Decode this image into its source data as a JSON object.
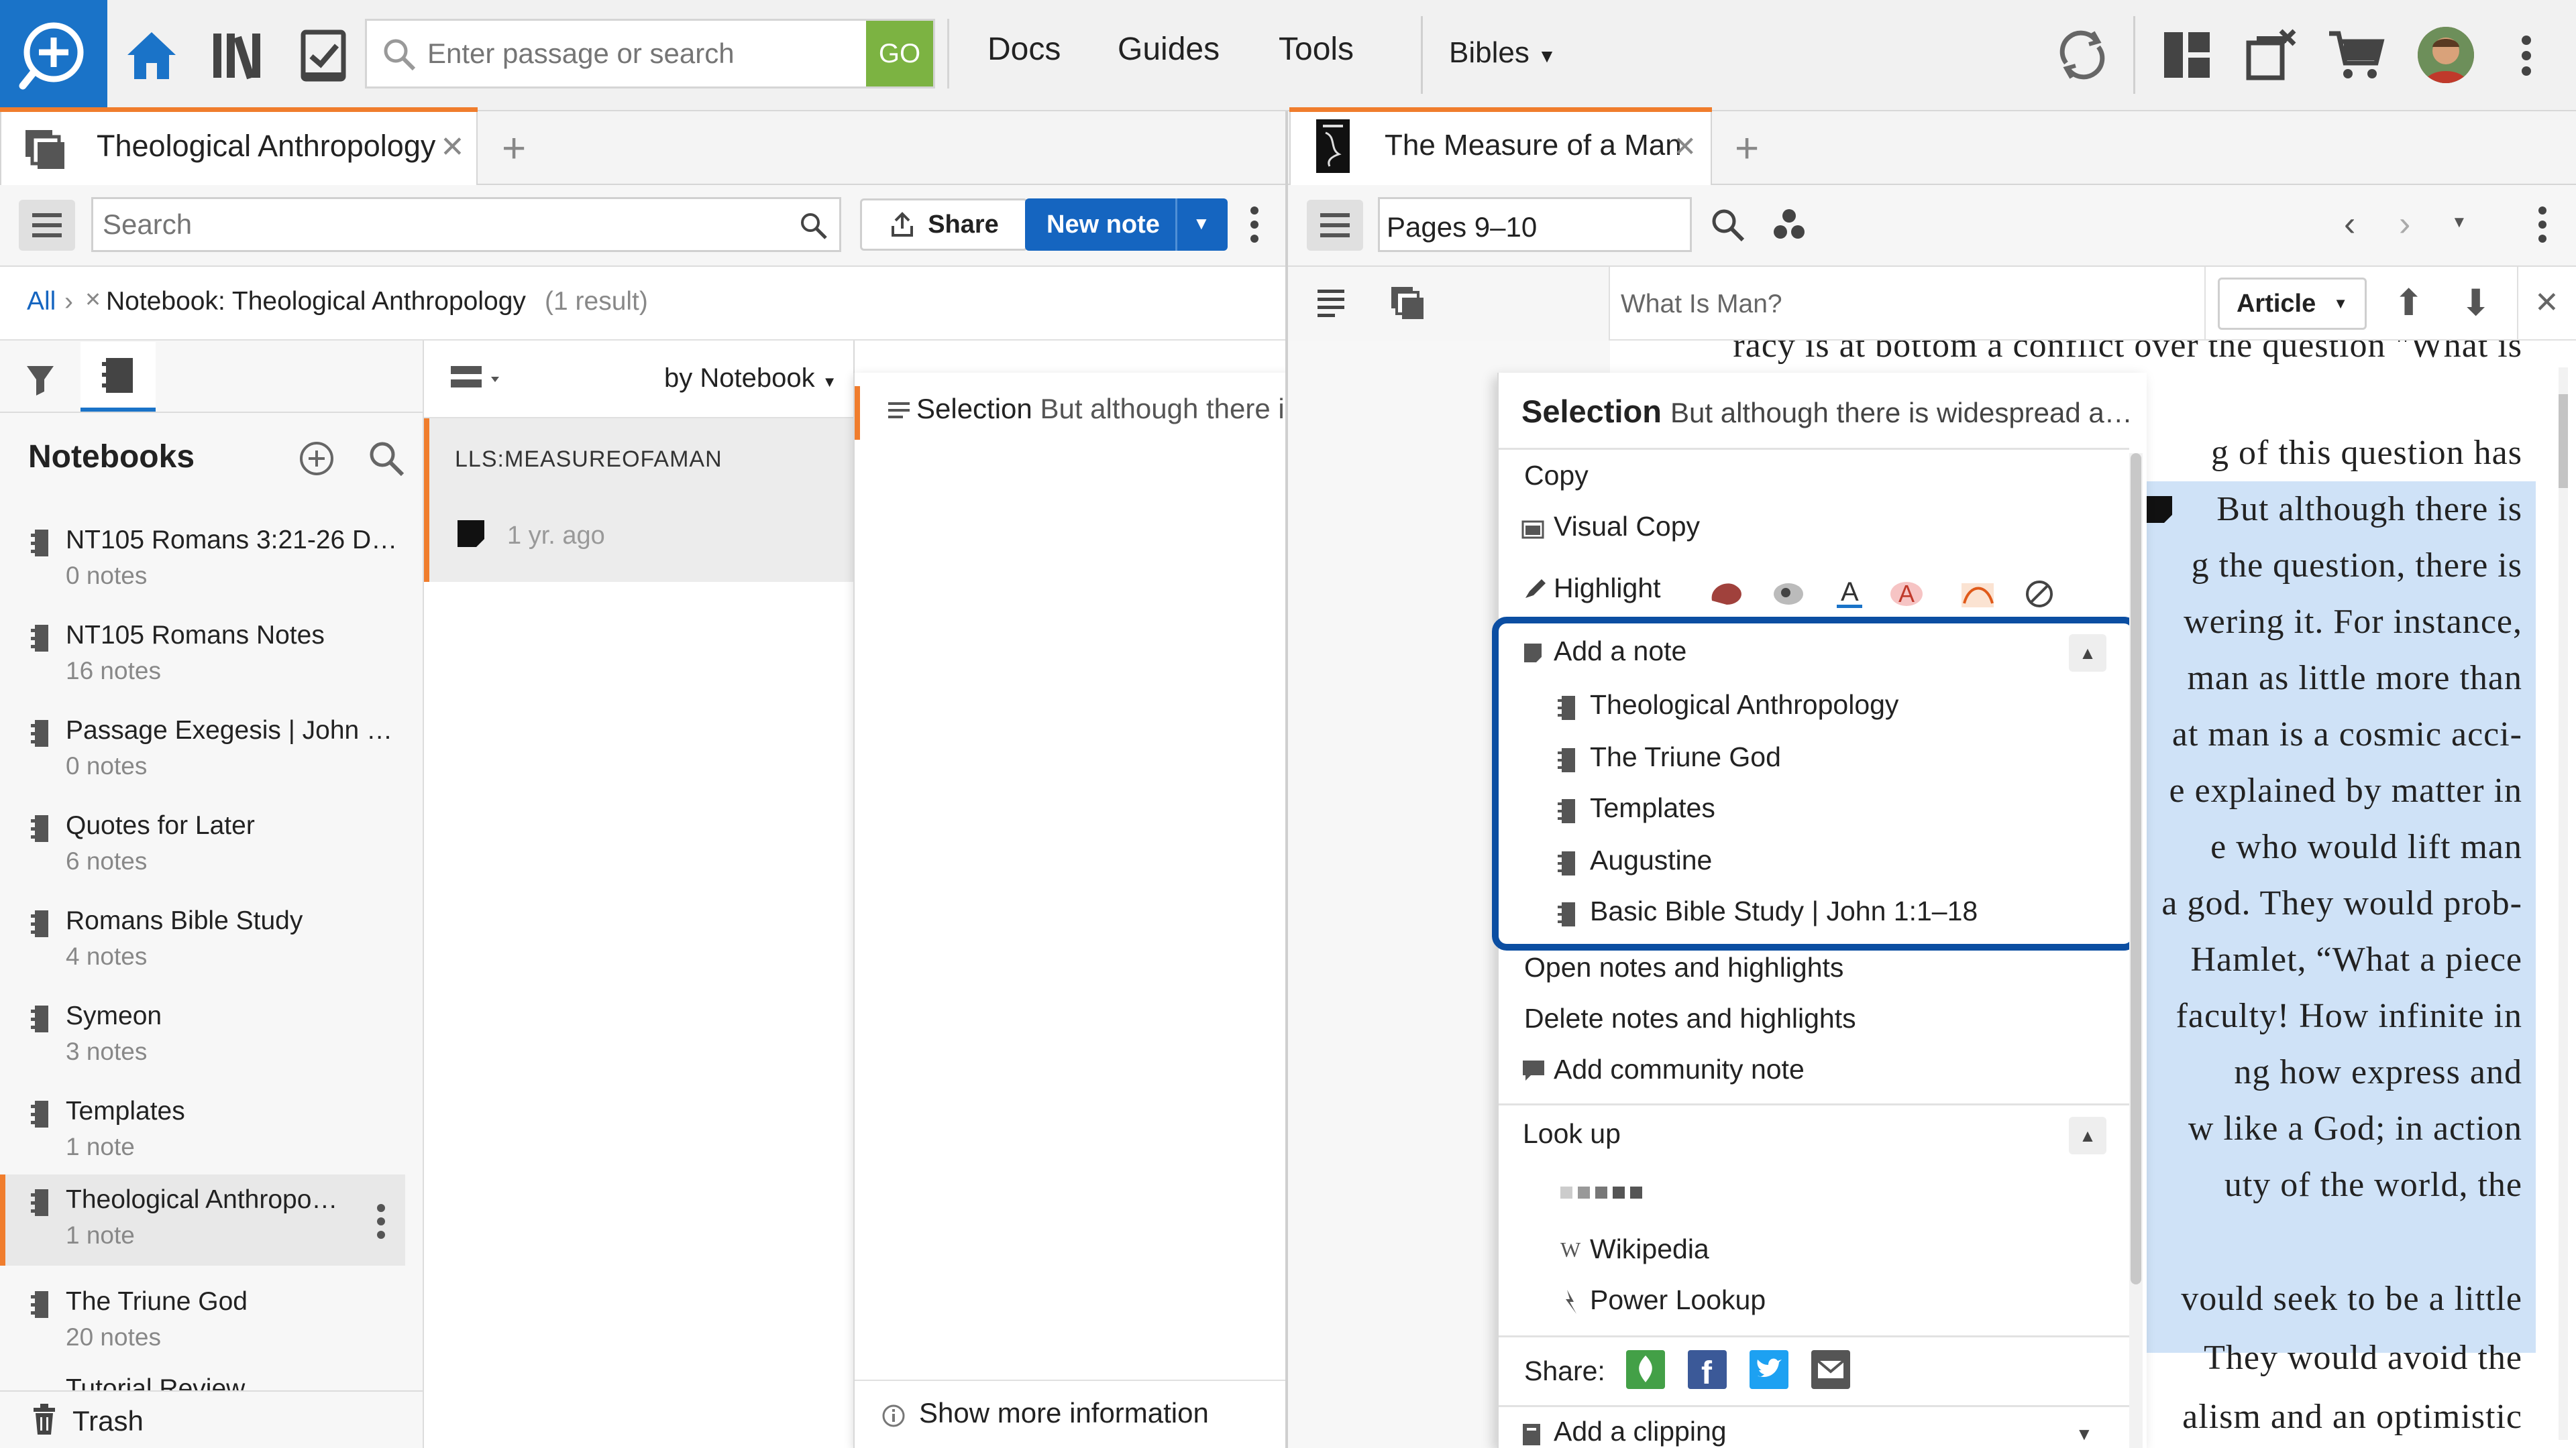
{
  "app": {
    "search_placeholder": "Enter passage or search",
    "go_label": "GO",
    "menu": {
      "docs": "Docs",
      "guides": "Guides",
      "tools": "Tools",
      "bibles": "Bibles"
    }
  },
  "left_panel": {
    "tab_title": "Theological Anthropology",
    "search_placeholder": "Search",
    "share_label": "Share",
    "new_note_label": "New note",
    "breadcrumb": {
      "all": "All",
      "separator": "›",
      "filter": "Notebook: Theological Anthropology",
      "result_count": "(1 result)"
    },
    "notebooks_title": "Notebooks",
    "sort_label": "by Notebook",
    "notebooks": [
      {
        "title": "NT105 Romans 3:21-26 Di…",
        "count": "0 notes"
      },
      {
        "title": "NT105 Romans Notes",
        "count": "16 notes"
      },
      {
        "title": "Passage Exegesis | John 1…",
        "count": "0 notes"
      },
      {
        "title": "Quotes for Later",
        "count": "6 notes"
      },
      {
        "title": "Romans Bible Study",
        "count": "4 notes"
      },
      {
        "title": "Symeon",
        "count": "3 notes"
      },
      {
        "title": "Templates",
        "count": "1 note"
      },
      {
        "title": "Theological Anthropo…",
        "count": "1 note"
      },
      {
        "title": "The Triune God",
        "count": "20 notes"
      },
      {
        "title": "Tutorial Review",
        "count": ""
      }
    ],
    "trash_label": "Trash",
    "note_group": "LLS:MEASUREOFAMAN",
    "note_time": "1 yr. ago",
    "note_editor": {
      "selection_title": "Selection",
      "selection_text": "But although there is widesprea…",
      "show_more": "Show more information"
    }
  },
  "context_menu": {
    "header_title": "Selection",
    "header_text": "But although there is widespread a…",
    "copy": "Copy",
    "visual_copy": "Visual Copy",
    "highlight": "Highlight",
    "add_note": "Add a note",
    "notebooks": [
      "Theological Anthropology",
      "The Triune God",
      "Templates",
      "Augustine",
      "Basic Bible Study | John 1:1–18"
    ],
    "open_notes": "Open notes and highlights",
    "delete_notes": "Delete notes and highlights",
    "community_note": "Add community note",
    "look_up": "Look up",
    "wikipedia": "Wikipedia",
    "power_lookup": "Power Lookup",
    "share": "Share:",
    "add_clipping": "Add a clipping",
    "focus_color": "#0b4ea2"
  },
  "right_panel": {
    "tab_title": "The Measure of a Man",
    "reference": "Pages 9–10",
    "section_title": "What Is Man?",
    "article_label": "Article",
    "lines": [
      "racy is at bottom a conflict over the question \"What is",
      "g of this question has",
      "But although there is",
      "g the question, there is",
      "wering it. For instance,",
      "man as little more than",
      "at man is a cosmic acci-",
      "e explained by matter in",
      "e who would lift man",
      "a god. They would prob-",
      "Hamlet, “What a piece",
      "faculty! How infinite in",
      "ng how express and",
      "w like a God; in action",
      "uty of the world, the",
      "vould seek to be a little",
      "They would avoid the",
      "alism and an optimistic"
    ]
  }
}
